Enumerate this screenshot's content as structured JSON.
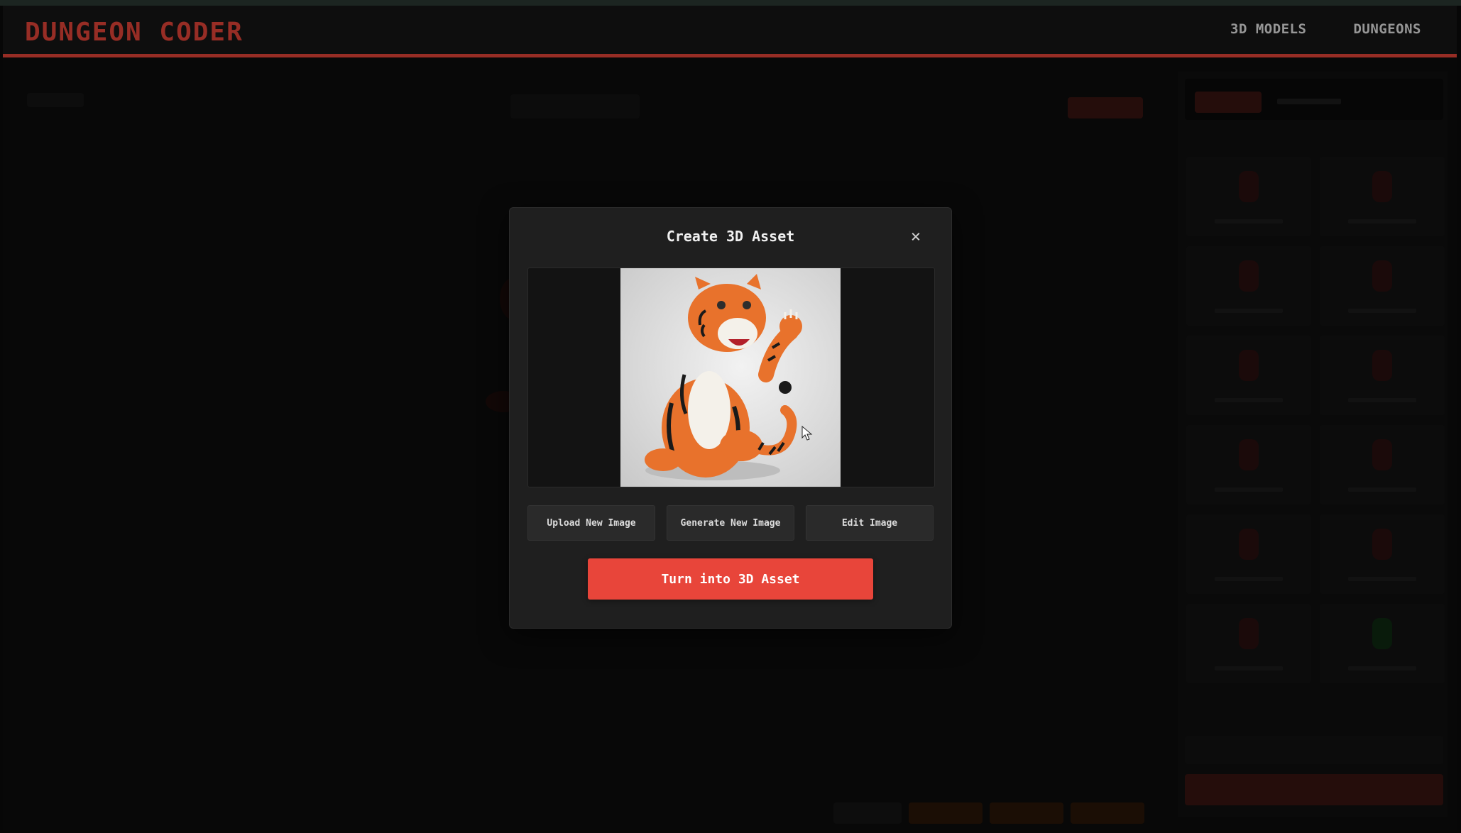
{
  "app": {
    "brand": "DUNGEON CODER"
  },
  "nav": {
    "items": [
      "3D MODELS",
      "DUNGEONS"
    ]
  },
  "modal": {
    "title": "Create 3D Asset",
    "close_glyph": "×",
    "image_subject": "tiger-figurine",
    "actions": {
      "upload": "Upload New Image",
      "generate": "Generate New Image",
      "edit": "Edit Image"
    },
    "primary": "Turn into 3D Asset"
  },
  "colors": {
    "accent": "#e8453a",
    "background": "#0d0d0d",
    "modal": "#1f1f1f",
    "button": "#2a2a2a"
  },
  "icons": [
    "close-icon",
    "cursor-pointer-icon"
  ]
}
